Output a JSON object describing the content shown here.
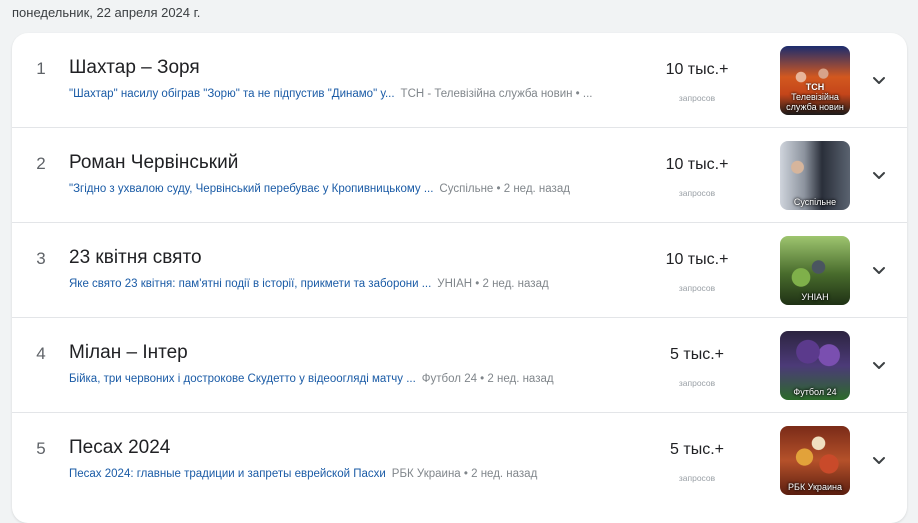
{
  "date_header": "понедельник, 22 апреля 2024 г.",
  "colors": {
    "page_background": "#f1f3f4",
    "card_background": "#ffffff",
    "link": "#1a5ba6",
    "muted": "#80868b"
  },
  "trends": [
    {
      "rank": "1",
      "title": "Шахтар – Зоря",
      "article": "\"Шахтар\" насилу обіграв \"Зорю\" та не підпустив \"Динамо\" у...",
      "source": "ТСН - Телевізійна служба новин • ...",
      "count": "10 тыс.+",
      "count_label": "запросов",
      "thumb_badge": "ТСН",
      "thumb_caption": "Телевізійна служба новин"
    },
    {
      "rank": "2",
      "title": "Роман Червінський",
      "article": "\"Згідно з ухвалою суду, Червінський перебуває у Кропивницькому ...",
      "source": "Суспільне • 2 нед. назад",
      "count": "10 тыс.+",
      "count_label": "запросов",
      "thumb_badge": "",
      "thumb_caption": "Суспільне"
    },
    {
      "rank": "3",
      "title": "23 квітня свято",
      "article": "Яке свято 23 квітня: пам'ятні події в історії, прикмети та заборони ...",
      "source": "УНІАН • 2 нед. назад",
      "count": "10 тыс.+",
      "count_label": "запросов",
      "thumb_badge": "",
      "thumb_caption": "УНІАН"
    },
    {
      "rank": "4",
      "title": "Мілан – Інтер",
      "article": "Бійка, три червоних і дострокове Скудетто у відеоогляді матчу ...",
      "source": "Футбол 24 • 2 нед. назад",
      "count": "5 тыс.+",
      "count_label": "запросов",
      "thumb_badge": "",
      "thumb_caption": "Футбол 24"
    },
    {
      "rank": "5",
      "title": "Песах 2024",
      "article": "Песах 2024: главные традиции и запреты еврейской Пасхи",
      "source": "РБК Украина • 2 нед. назад",
      "count": "5 тыс.+",
      "count_label": "запросов",
      "thumb_badge": "",
      "thumb_caption": "РБК Украина"
    }
  ],
  "icons": {
    "expand": "chevron-down-icon"
  }
}
